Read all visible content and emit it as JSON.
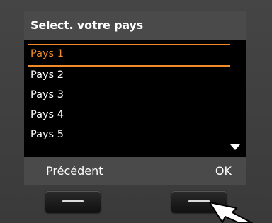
{
  "header": {
    "title": "Select. votre pays"
  },
  "list": {
    "items": [
      {
        "label": "Pays 1",
        "selected": true
      },
      {
        "label": "Pays 2",
        "selected": false
      },
      {
        "label": "Pays 3",
        "selected": false
      },
      {
        "label": "Pays 4",
        "selected": false
      },
      {
        "label": "Pays 5",
        "selected": false
      }
    ],
    "scroll_indicator_icon": "triangle-down-icon"
  },
  "softkeys": {
    "left_label": "Précédent",
    "right_label": "OK"
  },
  "hardware_keys": {
    "icon": "dash-icon"
  },
  "pointer": {
    "icon": "arrow-pointer-icon"
  },
  "colors": {
    "selection": "#f08a2a",
    "screen_bg": "#000000",
    "bar_bg": "#4a4a4a",
    "text": "#ffffff",
    "device_bg": "#3b3b3b"
  }
}
